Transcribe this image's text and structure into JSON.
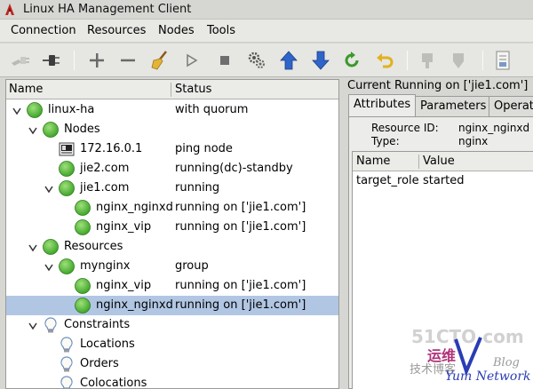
{
  "window": {
    "title": "Linux HA Management Client"
  },
  "menu": [
    "Connection",
    "Resources",
    "Nodes",
    "Tools"
  ],
  "tree": {
    "columns": {
      "name": "Name",
      "status": "Status"
    },
    "rows": [
      {
        "label": "linux-ha",
        "status": "with quorum",
        "icon": "green-status-icon",
        "expander": "open"
      },
      {
        "label": "Nodes",
        "status": "",
        "icon": "green-status-icon",
        "expander": "open"
      },
      {
        "label": "172.16.0.1",
        "status": "ping node",
        "icon": "ping-node-icon",
        "expander": "none"
      },
      {
        "label": "jie2.com",
        "status": "running(dc)-standby",
        "icon": "green-status-icon",
        "expander": "none"
      },
      {
        "label": "jie1.com",
        "status": "running",
        "icon": "green-status-icon",
        "expander": "open"
      },
      {
        "label": "nginx_nginxd",
        "status": "running on ['jie1.com']",
        "icon": "green-status-icon",
        "expander": "none"
      },
      {
        "label": "nginx_vip",
        "status": "running on ['jie1.com']",
        "icon": "green-status-icon",
        "expander": "none"
      },
      {
        "label": "Resources",
        "status": "",
        "icon": "green-status-icon",
        "expander": "open"
      },
      {
        "label": "mynginx",
        "status": "group",
        "icon": "green-status-icon",
        "expander": "open"
      },
      {
        "label": "nginx_vip",
        "status": "running on ['jie1.com']",
        "icon": "green-status-icon",
        "expander": "none"
      },
      {
        "label": "nginx_nginxd",
        "status": "running on ['jie1.com']",
        "icon": "green-status-icon",
        "expander": "none",
        "selected": true
      },
      {
        "label": "Constraints",
        "status": "",
        "icon": "bulb-icon",
        "expander": "open"
      },
      {
        "label": "Locations",
        "status": "",
        "icon": "bulb-icon",
        "expander": "none"
      },
      {
        "label": "Orders",
        "status": "",
        "icon": "bulb-icon",
        "expander": "none"
      },
      {
        "label": "Colocations",
        "status": "",
        "icon": "bulb-icon",
        "expander": "none"
      }
    ]
  },
  "detail": {
    "title": "Current Running on ['jie1.com']",
    "tabs": [
      "Attributes",
      "Parameters",
      "Operati"
    ],
    "resource_id_label": "Resource ID:",
    "resource_id": "nginx_nginxd",
    "type_label": "Type:",
    "type": "nginx",
    "table": {
      "columns": {
        "name": "Name",
        "value": "Value"
      },
      "rows": [
        {
          "name": "target_role",
          "value": "started"
        }
      ]
    }
  },
  "watermark": {
    "site": "51CTO.com",
    "cn_line1": "运维",
    "cn_line2": "技术博客",
    "blog": "Blog",
    "network": "Yum Network"
  },
  "colors": {
    "status_green": "#3fa52a",
    "selection": "#b1c6e3",
    "toolbar_arrow_blue": "#2f64c8"
  }
}
